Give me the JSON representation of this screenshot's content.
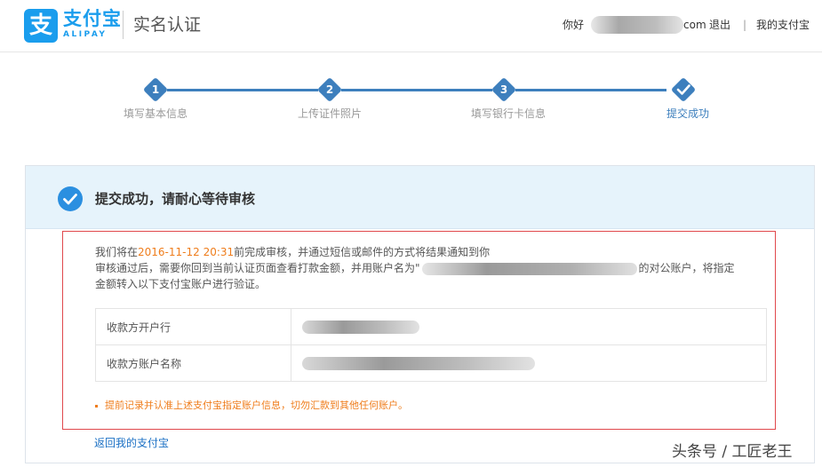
{
  "header": {
    "logo_glyph": "支",
    "logo_text": "支付宝",
    "logo_sub": "ALIPAY",
    "title": "实名认证",
    "greeting": "你好",
    "email_tail": "com",
    "logout": "退出",
    "separator": "|",
    "my_alipay": "我的支付宝",
    "brand_color": "#1a9ded"
  },
  "steps": [
    {
      "num": "1",
      "label": "填写基本信息"
    },
    {
      "num": "2",
      "label": "上传证件照片"
    },
    {
      "num": "3",
      "label": "填写银行卡信息"
    },
    {
      "num": "",
      "label": "提交成功"
    }
  ],
  "panel": {
    "title": "提交成功，请耐心等待审核",
    "line1_pre": "我们将在",
    "line1_date": "2016-11-12 20:31",
    "line1_post": "前完成审核，并通过短信或邮件的方式将结果通知到你",
    "line2_pre": "审核通过后，需要你回到当前认证页面查看打款金额，并用账户名为\"",
    "line2_post": "的对公账户，将指定",
    "line3": "金额转入以下支付宝账户进行验证。",
    "table": [
      {
        "key": "收款方开户行"
      },
      {
        "key": "收款方账户名称"
      }
    ],
    "notice": "提前记录并认准上述支付宝指定账户信息，切勿汇款到其他任何账户。",
    "back_link": "返回我的支付宝"
  },
  "watermark": "头条号 / 工匠老王",
  "colors": {
    "step": "#3d7fbd",
    "highlight": "#ef7d1c",
    "alert_border": "#e0484c",
    "link": "#1a6fc4"
  }
}
